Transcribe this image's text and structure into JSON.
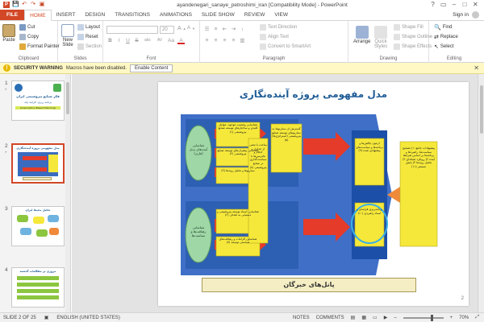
{
  "window": {
    "title": "ayandenegari_sanaye_petroshimi_iran [Compatibility Mode] - PowerPoint",
    "controls": [
      "?",
      "▭",
      "–",
      "□",
      "✕"
    ]
  },
  "quick_access": [
    "💾",
    "↶",
    "↷",
    "▣"
  ],
  "tabs": [
    "FILE",
    "HOME",
    "INSERT",
    "DESIGN",
    "TRANSITIONS",
    "ANIMATIONS",
    "SLIDE SHOW",
    "REVIEW",
    "VIEW"
  ],
  "active_tab": "HOME",
  "signin": "Sign in",
  "ribbon": {
    "clipboard": {
      "paste": "Paste",
      "cut": "Cut",
      "copy": "Copy",
      "format_painter": "Format Painter",
      "label": "Clipboard"
    },
    "slides": {
      "new_slide": "New Slide",
      "layout": "Layout",
      "reset": "Reset",
      "section": "Section",
      "label": "Slides"
    },
    "font": {
      "font_size": "20",
      "bold": "B",
      "italic": "I",
      "underline": "U",
      "strike": "S",
      "shadow": "abc",
      "spacing": "AV",
      "case": "Aa",
      "color": "A",
      "label": "Font"
    },
    "paragraph": {
      "text_direction": "Text Direction",
      "align_text": "Align Text",
      "convert_smartart": "Convert to SmartArt",
      "label": "Paragraph"
    },
    "drawing": {
      "arrange": "Arrange",
      "quick_styles": "Quick Styles",
      "shape_fill": "Shape Fill",
      "shape_outline": "Shape Outline",
      "shape_effects": "Shape Effects",
      "label": "Drawing"
    },
    "editing": {
      "find": "Find",
      "replace": "Replace",
      "select": "Select",
      "label": "Editing"
    }
  },
  "security": {
    "title": "SECURITY WARNING",
    "message": "Macros have been disabled.",
    "button": "Enable Content",
    "close": "✕"
  },
  "thumbnails": [
    {
      "number": "1",
      "star": "*",
      "text": [
        "فکر صنایع پتروشیمی ایران",
        "برنامه ریزی، فرایند پایه",
        "(Assumption-Based Planning)"
      ]
    },
    {
      "number": "2",
      "star": "*",
      "text": [
        "مدل مفهومی پروژه آینده‌نگاری"
      ]
    },
    {
      "number": "3",
      "star": "",
      "text": [
        "تحلیل محیط ایران"
      ]
    },
    {
      "number": "4",
      "star": "",
      "text": [
        "مروری بر مطالعات گذشته"
      ]
    }
  ],
  "slide": {
    "title": "مدل مفهومی پروژه آینده‌نگاری",
    "left_ovals": [
      "شناسایی آینده‌های بدیل (فازی)",
      "شناسایی رهیافت‌ها و سیاست‌ها"
    ],
    "top_band": [
      "شناسایی وضعیت موجود، عوامل کلیدی و ساختارهای توسعه صنایع پتروشیمی (۱)",
      "شناسایی پیشران‌های توسعه صنایع پتروشیمی (۲)",
      "سناریوها و تحلیل روندها (۳)"
    ],
    "mid_top": "گسترش آن سناریوها به سناریوهای توسعه صنایع پتروشیمی (استراتژی‌ها) (۵)",
    "bottom_band": [
      "شناسایی اسناد توسعه پتروشیمی و دستیابی به اهداف (۶)",
      "شناسایی الزامات و رهیافت‌های سیاستی توسعه (۷)"
    ],
    "center_box": "ساخت با معنی از جداول و ادغام و ماتریس‌ها با سیاست‌گذاری در صنایع پتروشیمی (۸)",
    "blue_top": "آزمون چالش‌ها و برنامه‌ها و سیاست‌های پیشنهادی شده (۹)",
    "blue_bottom": "برنامه‌ریزی فرآیندی و اسناد راهبردی (۱۰)",
    "right_box": "پیشنهادات جامع: ۱) تصحیح سیاست‌ها، راهبردها و برنامه‌ها بر اساس شرایط آینده ۲) رویکرد شبکه‌ای ۳) تحلیل روندها ۴) پایش مستمر (۱۱)",
    "footer": "پانل‌های خبرگان",
    "number": "2"
  },
  "status": {
    "slide": "SLIDE 2 OF 25",
    "language": "ENGLISH (UNITED STATES)",
    "notes": "NOTES",
    "comments": "COMMENTS",
    "zoom": "70%"
  }
}
